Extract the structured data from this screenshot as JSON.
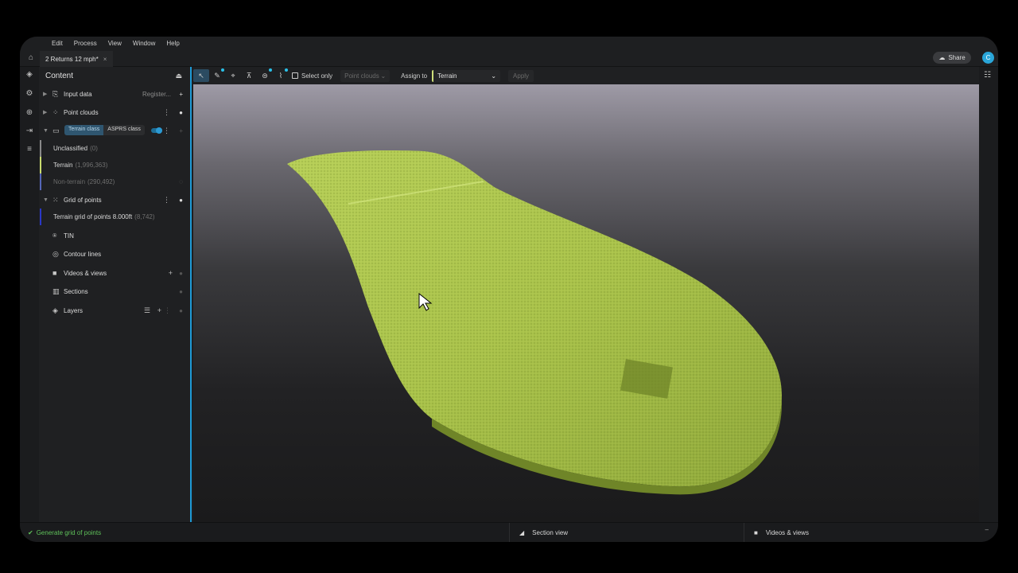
{
  "menu": [
    "Edit",
    "Process",
    "View",
    "Window",
    "Help"
  ],
  "tab": {
    "title": "2 Returns 12 mph*",
    "close": "×"
  },
  "share": {
    "label": "Share"
  },
  "user": {
    "initial": "C"
  },
  "panel": {
    "title": "Content",
    "input_data": {
      "label": "Input data",
      "action": "Register..."
    },
    "point_clouds": {
      "label": "Point clouds"
    },
    "classification": {
      "seg_active": "Terrain class",
      "seg_inactive": "ASPRS class",
      "classes": [
        {
          "label": "Unclassified",
          "count": "(0)",
          "color": "#8a8a8a"
        },
        {
          "label": "Terrain",
          "count": "(1,996,363)",
          "color": "#c9db6f"
        },
        {
          "label": "Non-terrain",
          "count": "(290,492)",
          "color": "#5566b8"
        }
      ]
    },
    "grid": {
      "label": "Grid of points",
      "child_label": "Terrain grid of points 8.000ft",
      "child_count": "(8,742)",
      "child_color": "#2a38c8"
    },
    "tin": {
      "label": "TIN"
    },
    "contours": {
      "label": "Contour lines"
    },
    "videos": {
      "label": "Videos & views"
    },
    "sections": {
      "label": "Sections"
    },
    "layers": {
      "label": "Layers"
    }
  },
  "toolbar": {
    "select_only": "Select only",
    "point_clouds_dropdown": "Point clouds",
    "assign_to": "Assign to",
    "assign_value": "Terrain",
    "apply": "Apply"
  },
  "statusbar": {
    "message": "Generate grid of points",
    "section_view": "Section view",
    "videos_views": "Videos & views"
  },
  "colors": {
    "accent": "#1e9ad6",
    "terrain": "#c9db6f",
    "status_ok": "#5fc15a"
  }
}
